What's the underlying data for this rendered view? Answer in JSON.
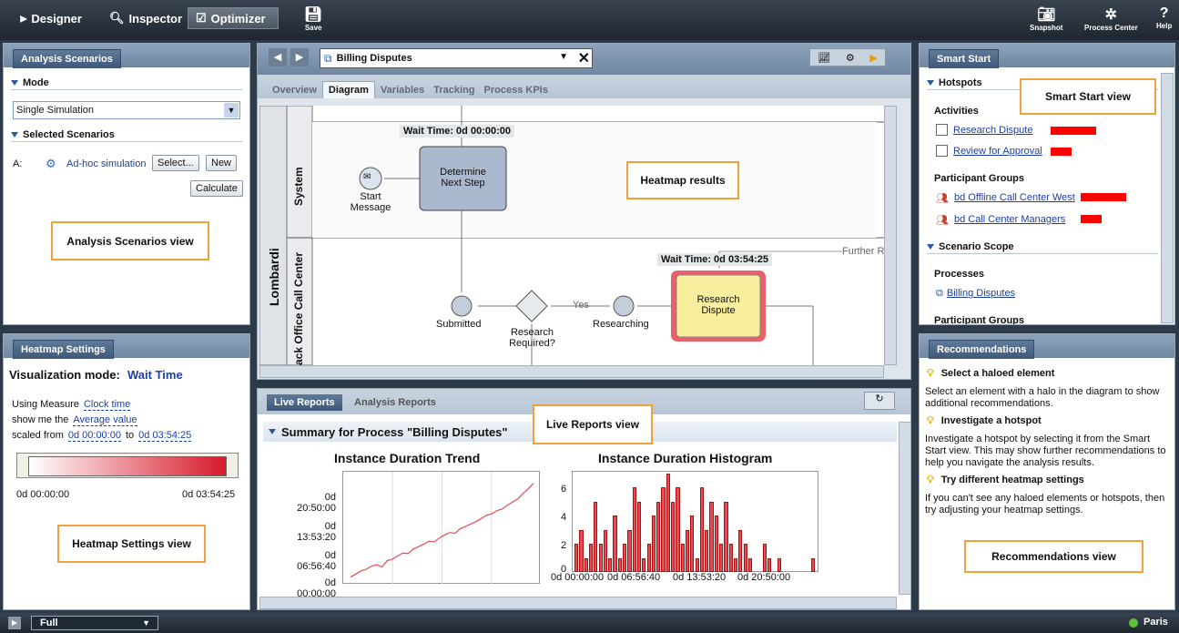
{
  "toolbar": {
    "tabs": [
      {
        "label": "Designer"
      },
      {
        "label": "Inspector"
      },
      {
        "label": "Optimizer"
      }
    ],
    "save": "Save",
    "snapshot": "Snapshot",
    "process_center": "Process Center",
    "help": "Help"
  },
  "analysis": {
    "tab": "Analysis Scenarios",
    "mode_label": "Mode",
    "mode_value": "Single Simulation",
    "selected_label": "Selected Scenarios",
    "row_label": "A:",
    "scenario": "Ad-hoc simulation",
    "select_btn": "Select...",
    "new_btn": "New",
    "calc_btn": "Calculate",
    "callout": "Analysis Scenarios view"
  },
  "heatmap": {
    "tab": "Heatmap Settings",
    "viz_label": "Visualization mode:",
    "viz_value": "Wait Time",
    "measure_prefix": "Using Measure",
    "measure": "Clock time",
    "showme_prefix": "show me the",
    "showme": "Average value",
    "scaled_prefix": "scaled from",
    "from": "0d 00:00:00",
    "to_word": "to",
    "to": "0d 03:54:25",
    "grad_min": "0d 00:00:00",
    "grad_max": "0d 03:54:25",
    "callout": "Heatmap Settings view"
  },
  "diagram": {
    "process": "Billing Disputes",
    "tabs": [
      "Overview",
      "Diagram",
      "Variables",
      "Tracking",
      "Process KPIs"
    ],
    "wait1": "Wait Time: 0d 00:00:00",
    "wait2": "Wait Time: 0d 03:54:25",
    "lane_system": "System",
    "lane_back": "ack Office Call Center",
    "pool": "Lombardi",
    "start1": "Start",
    "start2": "Message",
    "det1": "Determine",
    "det2": "Next Step",
    "submitted": "Submitted",
    "req1": "Research",
    "req2": "Required?",
    "yes": "Yes",
    "researching": "Researching",
    "rd1": "Research",
    "rd2": "Dispute",
    "further": "Further R",
    "callout": "Heatmap results"
  },
  "reports": {
    "tabs": [
      "Live Reports",
      "Analysis Reports"
    ],
    "summary": "Summary for Process \"Billing Disputes\"",
    "callout": "Live Reports view",
    "trend_title": "Instance Duration Trend",
    "hist_title": "Instance Duration Histogram",
    "trend_yticks": [
      "0d 20:50:00",
      "0d 13:53:20",
      "0d 06:56:40",
      "0d 00:00:00"
    ],
    "hist_yticks": [
      "6",
      "4",
      "2",
      "0"
    ],
    "hist_xticks": [
      "0d 00:00:00",
      "0d 06:56:40",
      "0d 13:53:20",
      "0d 20:50:00"
    ]
  },
  "chart_data": [
    {
      "type": "line",
      "title": "Instance Duration Trend",
      "yticks": [
        "0d 00:00:00",
        "0d 06:56:40",
        "0d 13:53:20",
        "0d 20:50:00"
      ],
      "ylim": [
        0,
        27
      ],
      "series": [
        {
          "values": [
            1.0,
            1.8,
            2.6,
            3.0,
            3.8,
            4.2,
            3.6,
            5.2,
            5.6,
            6.4,
            7.2,
            7.0,
            8.2,
            8.8,
            9.4,
            10.2,
            10.0,
            11.0,
            11.8,
            12.4,
            12.2,
            13.4,
            14.0,
            14.6,
            15.2,
            16.0,
            16.8,
            17.2,
            18.0,
            18.4,
            19.4,
            20.2,
            21.0,
            22.4,
            23.6,
            25.0
          ]
        }
      ]
    },
    {
      "type": "bar",
      "title": "Instance Duration Histogram",
      "ylim": [
        0,
        7
      ],
      "xticks": [
        "0d 00:00:00",
        "0d 06:56:40",
        "0d 13:53:20",
        "0d 20:50:00"
      ],
      "values": [
        2,
        3,
        1,
        2,
        5,
        2,
        3,
        1,
        4,
        1,
        2,
        3,
        6,
        5,
        1,
        2,
        4,
        5,
        6,
        7,
        5,
        6,
        2,
        3,
        4,
        1,
        6,
        3,
        5,
        4,
        2,
        5,
        2,
        1,
        3,
        2,
        1,
        0,
        0,
        2,
        1,
        0,
        1,
        0,
        0,
        0,
        0,
        0,
        0,
        1
      ]
    }
  ],
  "smart": {
    "tab": "Smart Start",
    "hotspots": "Hotspots",
    "activities": "Activities",
    "act1": "Research Dispute",
    "act2": "Review for Approval",
    "groups": "Participant Groups",
    "g1": "bd Offline Call Center West",
    "g2": "bd Call Center Managers",
    "scope": "Scenario Scope",
    "processes": "Processes",
    "proc1": "Billing Disputes",
    "groups2": "Participant Groups",
    "callout": "Smart Start view"
  },
  "rec": {
    "tab": "Recommendations",
    "h1": "Select a haloed element",
    "t1": "Select an element with a halo in the diagram to show additional recommendations.",
    "h2": "Investigate a hotspot",
    "t2": "Investigate a hotspot by selecting it from the Smart Start view. This may show further recommendations to help you navigate the analysis results.",
    "h3": "Try different heatmap settings",
    "t3": "If you can't see any haloed elements or hotspots, then try adjusting your heatmap settings.",
    "callout": "Recommendations view"
  },
  "status": {
    "mode": "Full",
    "server": "Paris"
  },
  "colors": {
    "accent": "#2a5aa6",
    "hot": "#e64b55",
    "callout": "#f2a03a"
  }
}
